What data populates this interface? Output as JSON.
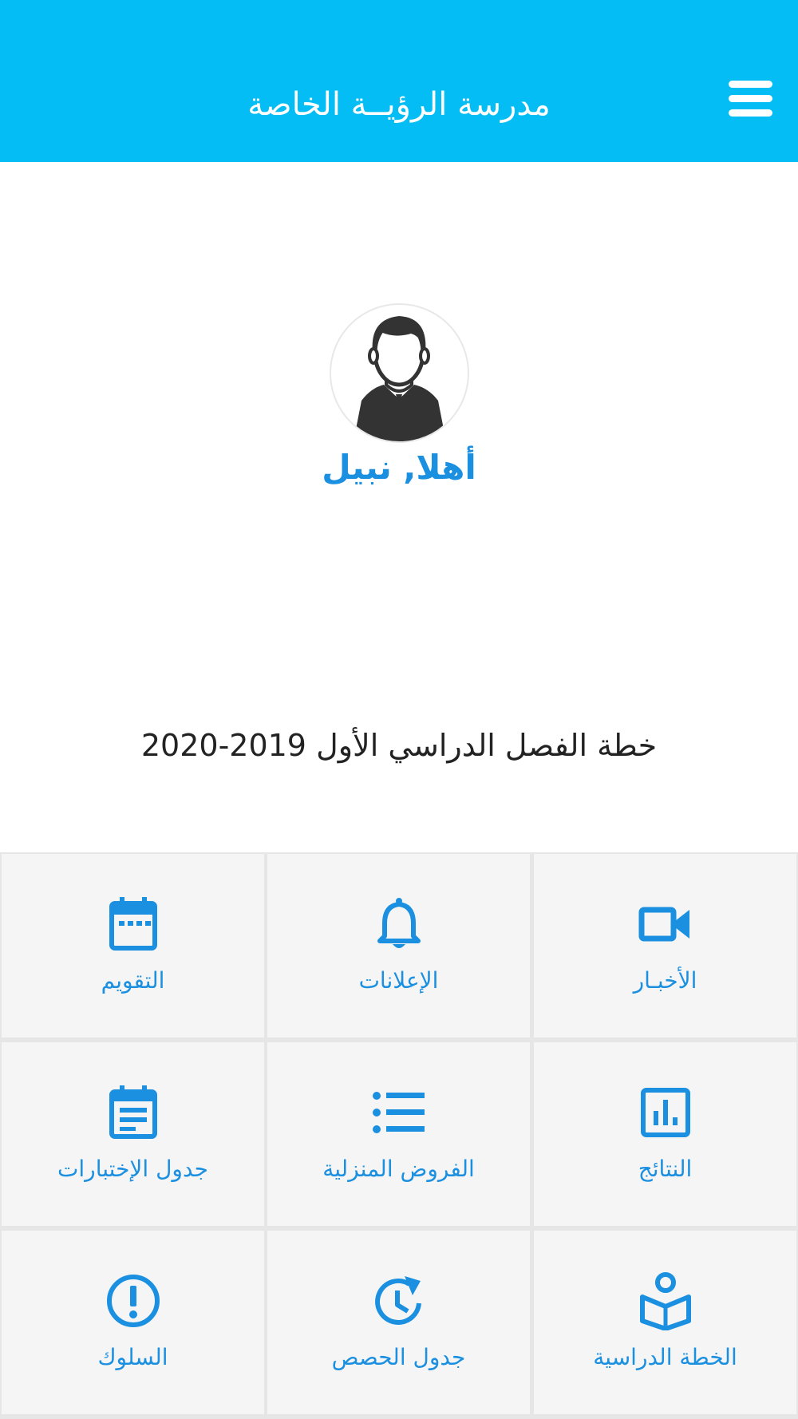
{
  "header": {
    "title": "مدرسة الرؤيــة الخاصة",
    "menu_icon": "hamburger-menu-icon",
    "background_color": "#03bdf4"
  },
  "profile": {
    "avatar_icon": "user-avatar-icon",
    "greeting": "أهلا, نبيل"
  },
  "plan": {
    "title": "خطة الفصل الدراسي الأول 2019-2020"
  },
  "accent_color": "#1b8fe0",
  "tiles": [
    {
      "label": "الأخبـار",
      "icon": "video-camera-icon"
    },
    {
      "label": "الإعلانات",
      "icon": "bell-icon"
    },
    {
      "label": "التقويم",
      "icon": "calendar-icon"
    },
    {
      "label": "النتائج",
      "icon": "bar-chart-icon"
    },
    {
      "label": "الفروض المنزلية",
      "icon": "list-icon"
    },
    {
      "label": "جدول الإختبارات",
      "icon": "schedule-icon"
    },
    {
      "label": "الخطة الدراسية",
      "icon": "book-reader-icon"
    },
    {
      "label": "جدول الحصص",
      "icon": "clock-refresh-icon"
    },
    {
      "label": "السلوك",
      "icon": "alert-circle-icon"
    }
  ]
}
